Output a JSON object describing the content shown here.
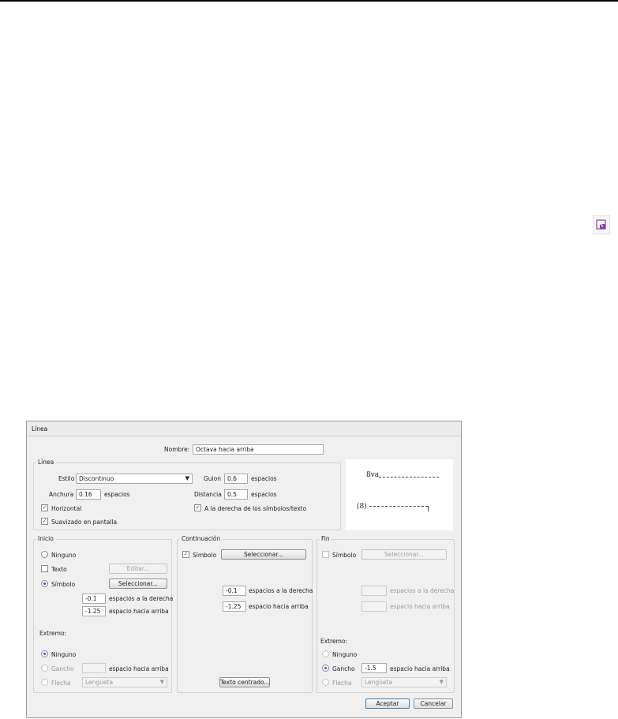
{
  "side_icon": "resize-icon",
  "dialog": {
    "title": "Línea",
    "nombre_label": "Nombre:",
    "nombre_value": "Octava hacia arriba",
    "linea_group": "Línea",
    "estilo_label": "Estilo",
    "estilo_value": "Discontinuo",
    "anchura_label": "Anchura",
    "anchura_value": "0.16",
    "anchura_unit": "espacios",
    "guion_label": "Guion",
    "guion_value": "0.6",
    "guion_unit": "espacios",
    "distancia_label": "Distancia",
    "distancia_value": "0.5",
    "distancia_unit": "espacios",
    "horizontal_label": "Horizontal",
    "horizontal_checked": true,
    "suavizado_label": "Suavizado en pantalla",
    "suavizado_checked": true,
    "derecha_label": "A la derecha de los símbolos/texto",
    "derecha_checked": true,
    "preview": {
      "top_symbol": "8va",
      "bottom_symbol": "(8)"
    },
    "inicio": {
      "group": "Inicio",
      "ninguno": "Ninguno",
      "texto": "Texto",
      "editar": "Editar...",
      "simbolo": "Símbolo",
      "seleccionar": "Seleccionar...",
      "selected": "simbolo",
      "derecha_value": "-0.1",
      "derecha_label": "espacios a la derecha",
      "arriba_value": "-1.25",
      "arriba_label": "espacio hacia arriba",
      "extremo": "Extremo:",
      "ext_ninguno": "Ninguno",
      "ext_gancho": "Gancho",
      "ext_gancho_label": "espacio hacia arriba",
      "ext_flecha": "Flecha",
      "ext_flecha_value": "Lengüeta",
      "ext_selected": "ninguno"
    },
    "continuacion": {
      "group": "Continuación",
      "simbolo": "Símbolo",
      "simbolo_checked": true,
      "seleccionar": "Seleccionar...",
      "derecha_value": "-0.1",
      "derecha_label": "espacios a la derecha",
      "arriba_value": "-1.25",
      "arriba_label": "espacio hacia arriba",
      "texto_centrado": "Texto centrado..."
    },
    "fin": {
      "group": "Fin",
      "simbolo": "Símbolo",
      "simbolo_checked": false,
      "seleccionar": "Seleccionar...",
      "derecha_label": "espacios a la derecha",
      "arriba_label": "espacio hacia arriba",
      "extremo": "Extremo:",
      "ext_ninguno": "Ninguno",
      "ext_gancho": "Gancho",
      "ext_gancho_value": "-1.5",
      "ext_gancho_label": "espacio hacia arriba",
      "ext_flecha": "Flecha",
      "ext_flecha_value": "Lengüeta",
      "ext_selected": "gancho"
    },
    "aceptar": "Aceptar",
    "cancelar": "Cancelar"
  }
}
